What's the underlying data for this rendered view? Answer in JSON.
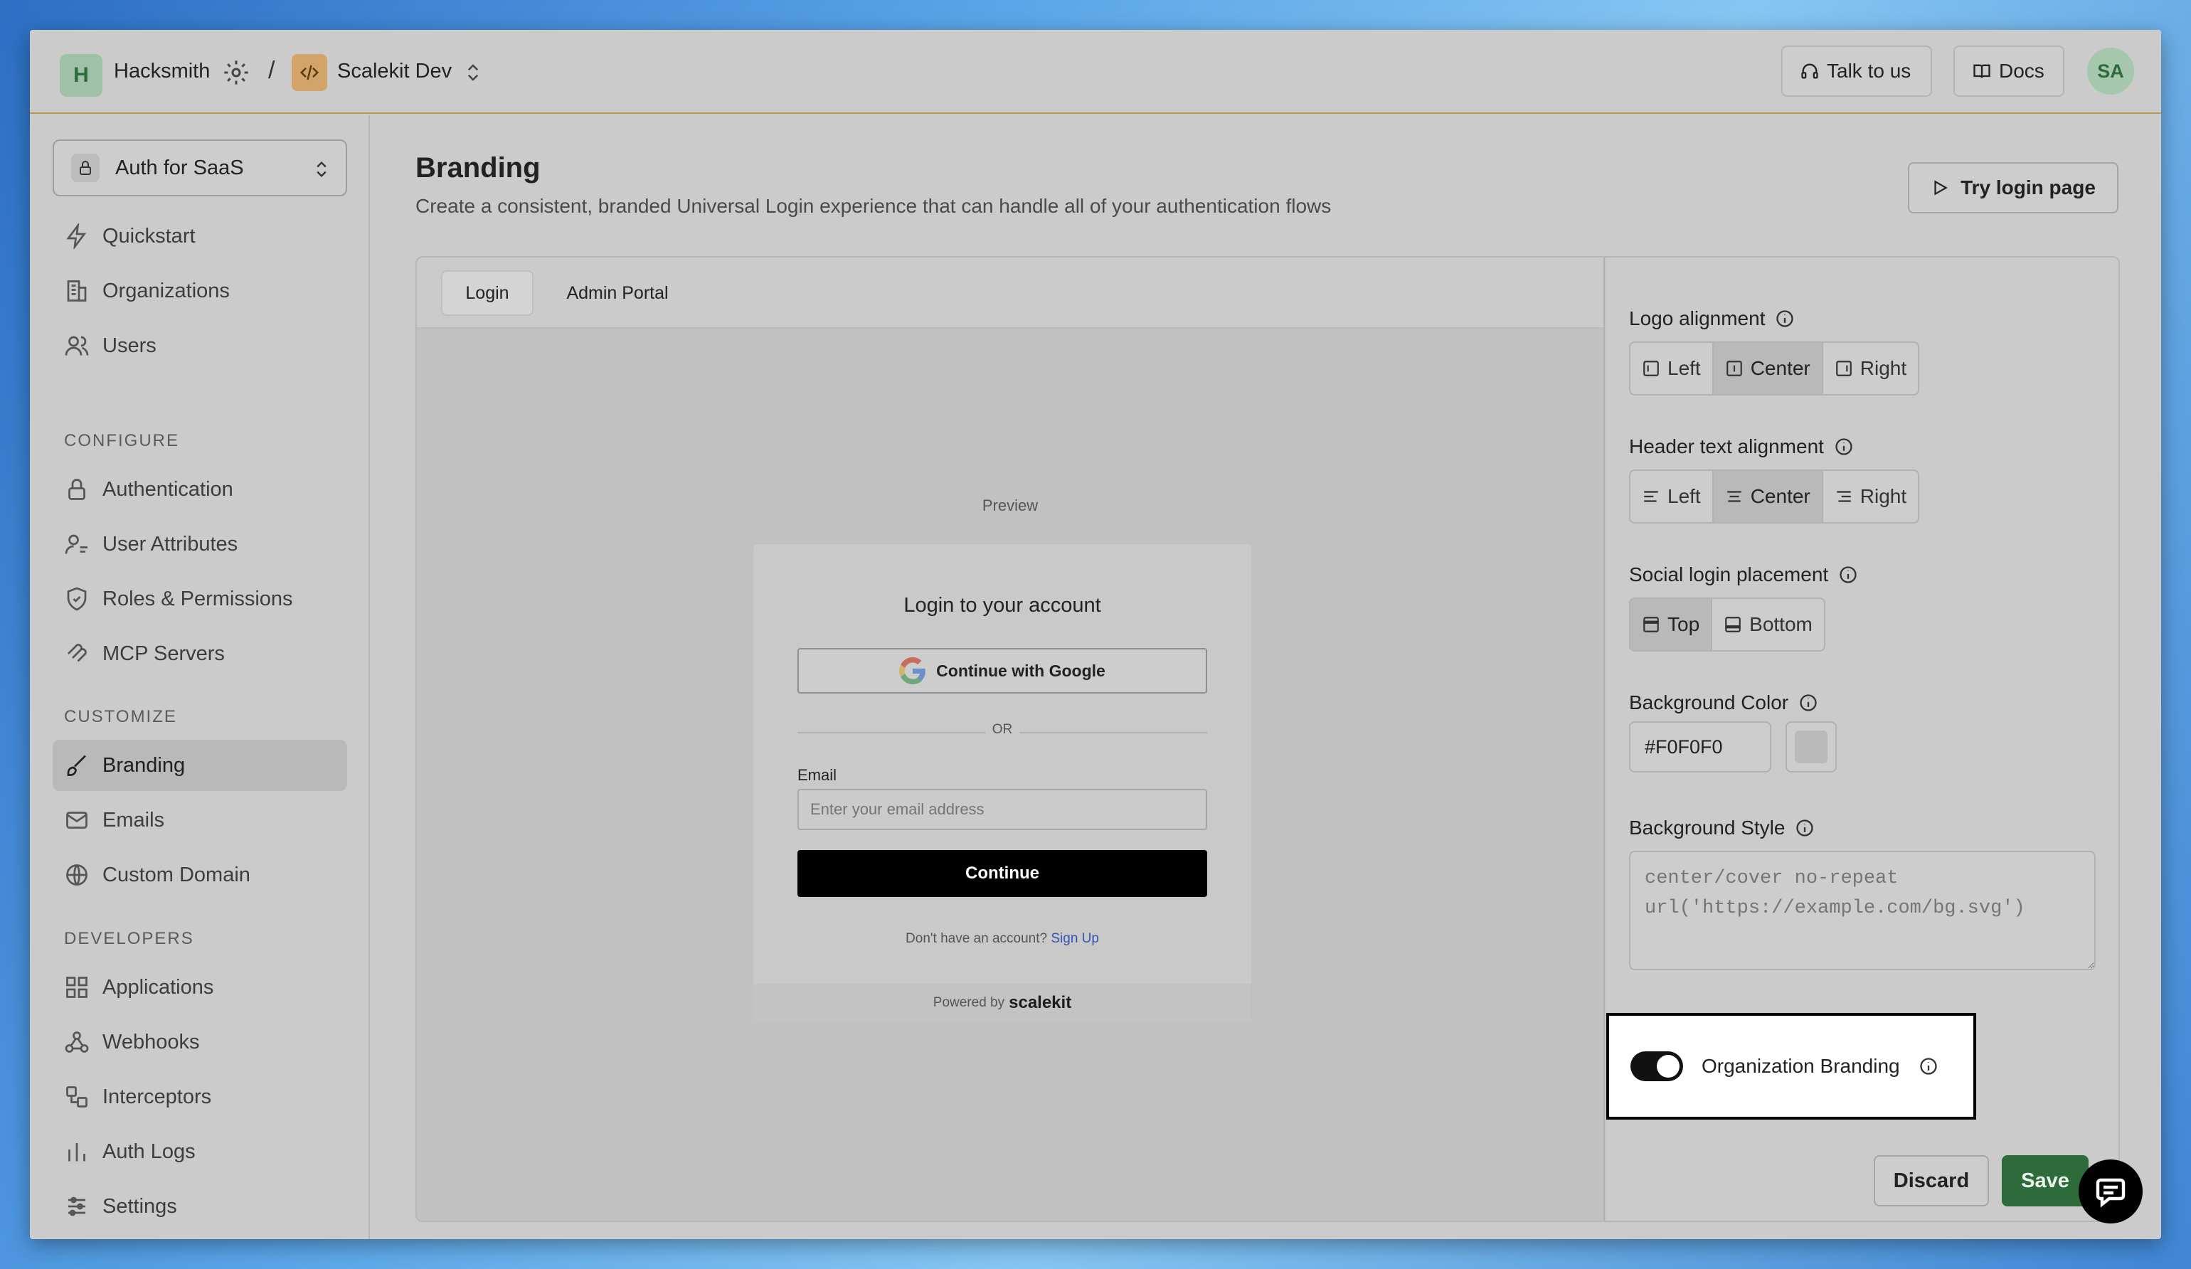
{
  "topbar": {
    "workspace_initial": "H",
    "workspace_name": "Hacksmith",
    "separator": "/",
    "environment_name": "Scalekit Dev",
    "talk_label": "Talk to us",
    "docs_label": "Docs",
    "avatar_initials": "SA"
  },
  "sidebar": {
    "app_selector": "Auth for SaaS",
    "items_top": [
      {
        "label": "Quickstart",
        "icon": "lightning-icon"
      },
      {
        "label": "Organizations",
        "icon": "building-icon"
      },
      {
        "label": "Users",
        "icon": "users-icon"
      }
    ],
    "configure_label": "CONFIGURE",
    "configure_items": [
      {
        "label": "Authentication",
        "icon": "lock-icon"
      },
      {
        "label": "User Attributes",
        "icon": "user-attributes-icon"
      },
      {
        "label": "Roles & Permissions",
        "icon": "shield-icon"
      },
      {
        "label": "MCP Servers",
        "icon": "mcp-icon"
      }
    ],
    "customize_label": "CUSTOMIZE",
    "customize_items": [
      {
        "label": "Branding",
        "icon": "paintbrush-icon",
        "active": true
      },
      {
        "label": "Emails",
        "icon": "mail-icon"
      },
      {
        "label": "Custom Domain",
        "icon": "globe-icon"
      }
    ],
    "developers_label": "DEVELOPERS",
    "developers_items": [
      {
        "label": "Applications",
        "icon": "grid-icon"
      },
      {
        "label": "Webhooks",
        "icon": "webhook-icon"
      },
      {
        "label": "Interceptors",
        "icon": "interceptor-icon"
      },
      {
        "label": "Auth Logs",
        "icon": "bar-chart-icon"
      },
      {
        "label": "Settings",
        "icon": "sliders-icon"
      }
    ]
  },
  "main": {
    "title": "Branding",
    "subtitle": "Create a consistent, branded Universal Login experience that can handle all of your authentication flows",
    "try_login_label": "Try login page",
    "tabs": [
      {
        "label": "Login",
        "active": true
      },
      {
        "label": "Admin Portal",
        "active": false
      }
    ],
    "preview_label": "Preview"
  },
  "login_card": {
    "title": "Login to your account",
    "google_button": "Continue with Google",
    "or_text": "OR",
    "email_label": "Email",
    "email_placeholder": "Enter your email address",
    "continue_button": "Continue",
    "signup_prompt": "Don't have an account?",
    "signup_link": "Sign Up",
    "powered_by": "Powered by",
    "powered_brand": "scalekit"
  },
  "settings": {
    "logo_alignment": {
      "label": "Logo alignment",
      "options": [
        "Left",
        "Center",
        "Right"
      ],
      "selected": "Center"
    },
    "header_text_alignment": {
      "label": "Header text alignment",
      "options": [
        "Left",
        "Center",
        "Right"
      ],
      "selected": "Center"
    },
    "social_login_placement": {
      "label": "Social login placement",
      "options": [
        "Top",
        "Bottom"
      ],
      "selected": "Top"
    },
    "background_color": {
      "label": "Background Color",
      "value": "#F0F0F0"
    },
    "background_style": {
      "label": "Background Style",
      "placeholder": "center/cover no-repeat url('https://example.com/bg.svg')"
    },
    "organization_branding": {
      "label": "Organization Branding",
      "enabled": true
    },
    "discard_label": "Discard",
    "save_label": "Save"
  },
  "colors": {
    "accent_green": "#2e6b3a",
    "link_blue": "#3553b5",
    "divider_gold": "#b89a4a"
  }
}
